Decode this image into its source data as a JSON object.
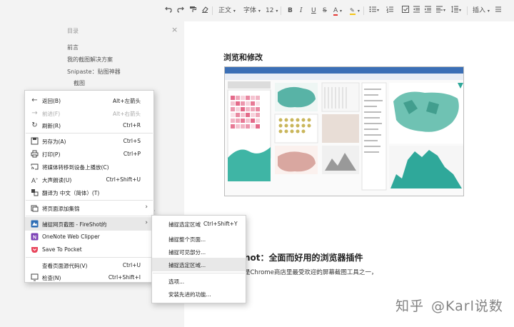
{
  "toolbar": {
    "undo": "undo-icon",
    "redo": "redo-icon",
    "format_painter": "format-painter-icon",
    "clear_format": "eraser-icon",
    "style": "正文",
    "font": "字体",
    "size": "12",
    "bold": "B",
    "italic": "I",
    "underline": "U",
    "strike": "S",
    "font_color": "A",
    "highlight": "highlight-icon",
    "insert": "插入",
    "font_color_value": "#e53935",
    "highlight_value": "#f5c518"
  },
  "outline": {
    "title": "目录",
    "items": [
      "前言",
      "我的截图解决方案",
      "Snipaste：贴图神器",
      "截图"
    ]
  },
  "document": {
    "heading": "浏览和修改",
    "heading2": "hot：全面而好用的浏览器插件",
    "paragraph": "是Chrome商店里最受欢迎的屏幕截图工具之一，",
    "watermark_brand": "知乎",
    "watermark_user": "@Karl说数"
  },
  "context_menu": {
    "items": [
      {
        "label": "返回(B)",
        "shortcut": "Alt+左箭头",
        "icon": "back-arrow-icon",
        "disabled": false
      },
      {
        "label": "前进(F)",
        "shortcut": "Alt+右箭头",
        "icon": "forward-arrow-icon",
        "disabled": true
      },
      {
        "label": "刷新(R)",
        "shortcut": "Ctrl+R",
        "icon": "refresh-icon",
        "disabled": false
      },
      {
        "label": "另存为(A)",
        "shortcut": "Ctrl+S",
        "icon": "save-as-icon",
        "disabled": false
      },
      {
        "label": "打印(P)",
        "shortcut": "Ctrl+P",
        "icon": "print-icon",
        "disabled": false
      },
      {
        "label": "将媒体转移到设备上播放(C)",
        "shortcut": "",
        "icon": "cast-icon",
        "disabled": false
      },
      {
        "label": "大声朗读(U)",
        "shortcut": "Ctrl+Shift+U",
        "icon": "read-aloud-icon",
        "disabled": false
      },
      {
        "label": "翻译为 中文（简体）(T)",
        "shortcut": "",
        "icon": "translate-icon",
        "disabled": false
      },
      {
        "label": "将页面添加集锦",
        "shortcut": "",
        "icon": "collections-icon",
        "disabled": false
      },
      {
        "label": "捕捉网页截图 - FireShot的",
        "shortcut": "",
        "icon": "fireshot-icon",
        "disabled": false
      },
      {
        "label": "OneNote Web Clipper",
        "shortcut": "",
        "icon": "onenote-icon",
        "disabled": false
      },
      {
        "label": "Save To Pocket",
        "shortcut": "",
        "icon": "pocket-icon",
        "disabled": false
      },
      {
        "label": "查看页面源代码(V)",
        "shortcut": "Ctrl+U",
        "icon": "",
        "disabled": false
      },
      {
        "label": "检查(N)",
        "shortcut": "Ctrl+Shift+I",
        "icon": "inspect-icon",
        "disabled": false
      }
    ]
  },
  "submenu": {
    "items": [
      {
        "label": "捕捉选定区域",
        "shortcut": "Ctrl+Shift+Y"
      },
      {
        "label": "捕捉整个页面...",
        "shortcut": ""
      },
      {
        "label": "捕捉可见部分...",
        "shortcut": ""
      },
      {
        "label": "捕捉选定区域...",
        "shortcut": ""
      },
      {
        "label": "选项...",
        "shortcut": ""
      },
      {
        "label": "安装先进的功能...",
        "shortcut": ""
      }
    ]
  }
}
